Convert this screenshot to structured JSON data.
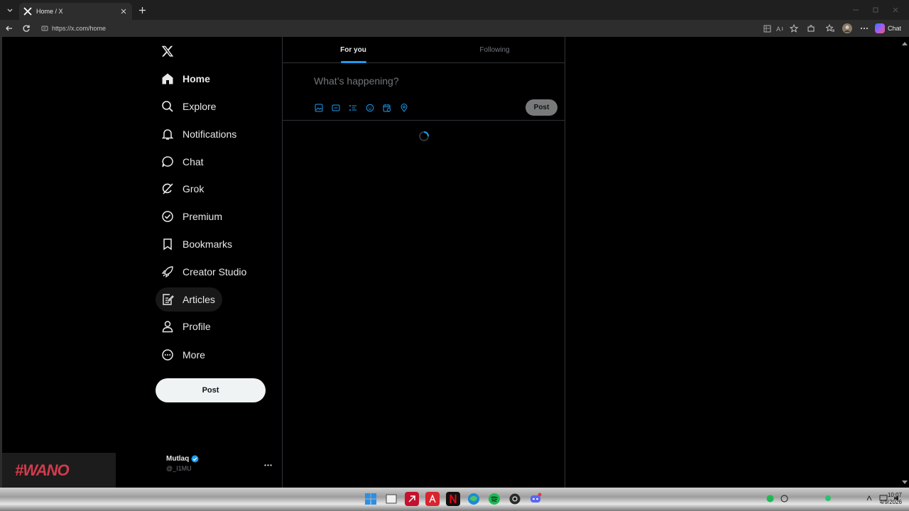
{
  "browser": {
    "tab_title": "Home / X",
    "url": "https://x.com/home",
    "chat_label": "Chat"
  },
  "sidebar": {
    "items": [
      {
        "label": "Home",
        "icon": "home-icon"
      },
      {
        "label": "Explore",
        "icon": "search-icon"
      },
      {
        "label": "Notifications",
        "icon": "bell-icon"
      },
      {
        "label": "Chat",
        "icon": "chat-bubble-icon"
      },
      {
        "label": "Grok",
        "icon": "grok-icon"
      },
      {
        "label": "Premium",
        "icon": "verified-badge-icon"
      },
      {
        "label": "Bookmarks",
        "icon": "bookmark-icon"
      },
      {
        "label": "Creator Studio",
        "icon": "rocket-icon"
      },
      {
        "label": "Articles",
        "icon": "article-edit-icon"
      },
      {
        "label": "Profile",
        "icon": "person-icon"
      },
      {
        "label": "More",
        "icon": "more-circle-icon"
      }
    ],
    "post_label": "Post"
  },
  "account": {
    "name": "Mutlaq",
    "handle": "@_I1MU"
  },
  "stream_badge": "#WANO",
  "timeline": {
    "tabs": [
      {
        "label": "For you",
        "active": true
      },
      {
        "label": "Following",
        "active": false
      }
    ],
    "composer_placeholder": "What’s happening?",
    "composer_post_label": "Post"
  },
  "taskbar": {
    "time": "10:07",
    "date": "4/9/2026"
  },
  "colors": {
    "accent": "#1d9bf0",
    "text": "#e7e9ea",
    "muted": "#71767b",
    "border": "#2f3336"
  }
}
